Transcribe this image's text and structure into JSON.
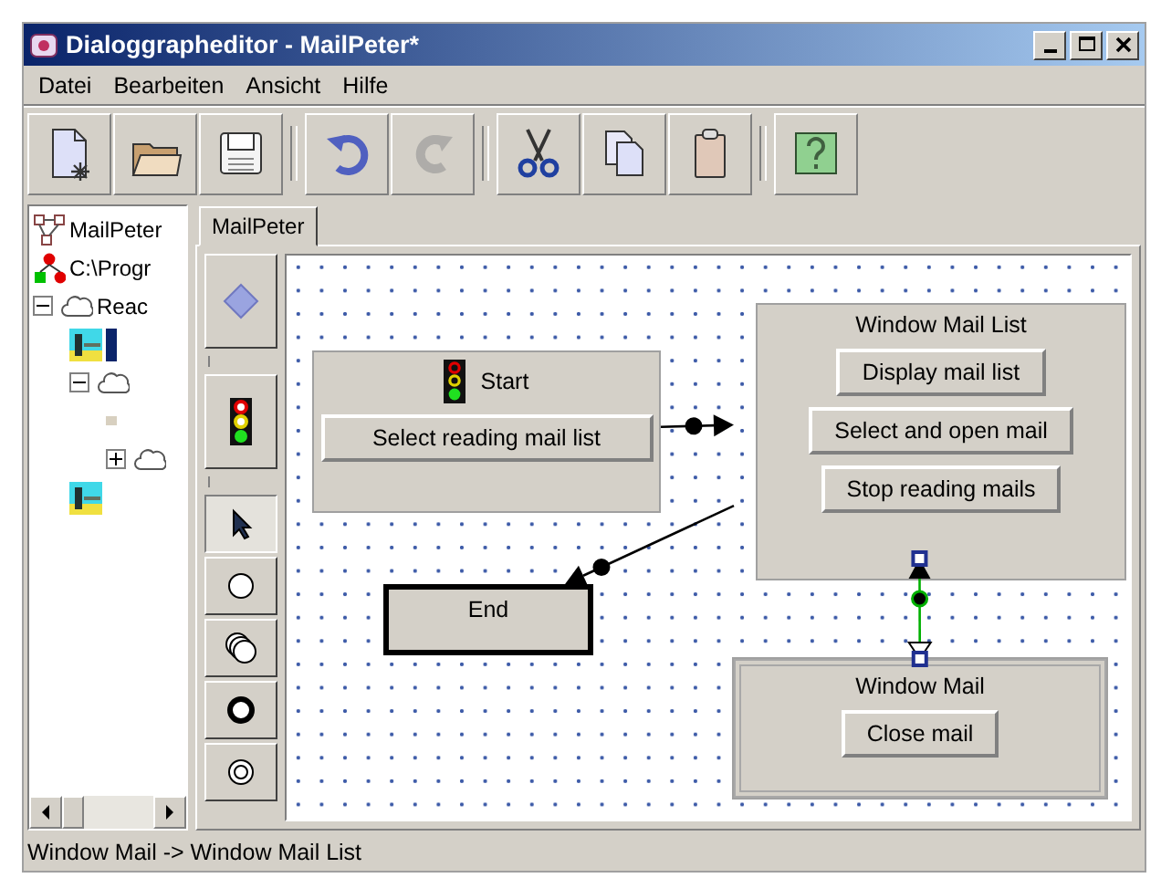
{
  "window": {
    "title": "Dialoggrapheditor - MailPeter*"
  },
  "menu": [
    "Datei",
    "Bearbeiten",
    "Ansicht",
    "Hilfe"
  ],
  "toolbar": [
    {
      "kind": "new",
      "disabled": false
    },
    {
      "kind": "open",
      "disabled": false
    },
    {
      "kind": "save",
      "disabled": false
    },
    {
      "kind": "separator"
    },
    {
      "kind": "undo",
      "disabled": false
    },
    {
      "kind": "redo",
      "disabled": true
    },
    {
      "kind": "separator"
    },
    {
      "kind": "cut",
      "disabled": false
    },
    {
      "kind": "copy",
      "disabled": false
    },
    {
      "kind": "paste",
      "disabled": false
    },
    {
      "kind": "separator"
    },
    {
      "kind": "help",
      "disabled": false
    }
  ],
  "tree": [
    {
      "kind": "project",
      "label": "MailPeter",
      "selected": false
    },
    {
      "kind": "path",
      "label": "C:\\Progr",
      "selected": false
    },
    {
      "kind": "group",
      "label": "Reac",
      "expanded": true,
      "selected": false,
      "children": [
        {
          "kind": "task",
          "selected": true
        },
        {
          "kind": "group",
          "expanded": true,
          "selected": false,
          "children": [
            {
              "kind": "item",
              "selected": false
            },
            {
              "kind": "group",
              "expanded": false,
              "selected": false
            }
          ]
        },
        {
          "kind": "task",
          "selected": false
        }
      ]
    }
  ],
  "tabs": [
    {
      "label": "MailPeter",
      "selected": true
    }
  ],
  "palette": [
    {
      "kind": "diamond",
      "selected": false
    },
    {
      "kind": "traffic-light",
      "selected": false
    },
    {
      "kind": "pointer",
      "selected": true
    },
    {
      "kind": "circle",
      "selected": false
    },
    {
      "kind": "multi-circle",
      "selected": false
    },
    {
      "kind": "bold-circle",
      "selected": false
    },
    {
      "kind": "ring",
      "selected": false
    }
  ],
  "diagram": {
    "nodes": [
      {
        "kind": "start",
        "title": "Start",
        "buttons": [
          "Select reading mail list"
        ]
      },
      {
        "kind": "window",
        "title": "Window Mail List",
        "buttons": [
          "Display mail list",
          "Select and open mail",
          "Stop reading mails"
        ]
      },
      {
        "kind": "end",
        "title": "End"
      },
      {
        "kind": "modal",
        "title": "Window Mail",
        "buttons": [
          "Close mail"
        ]
      }
    ],
    "edges": [
      {
        "selected": false
      },
      {
        "selected": false
      },
      {
        "selected": true
      }
    ]
  },
  "status_bar": "Window Mail -> Window Mail List"
}
